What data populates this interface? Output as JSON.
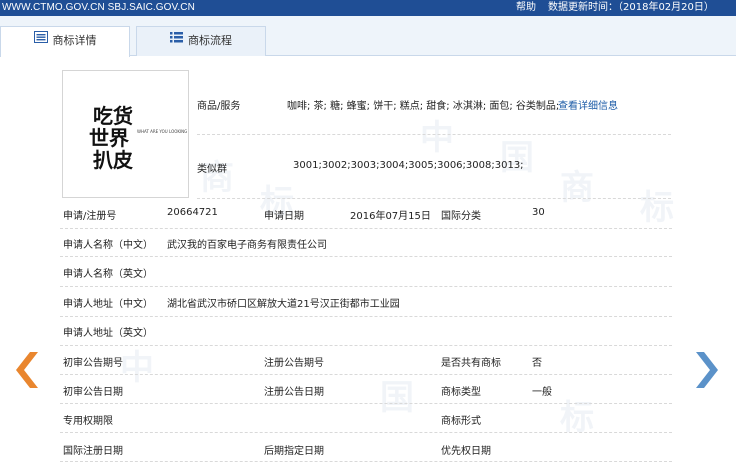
{
  "topbar": {
    "url": "WWW.CTMO.GOV.CN SBJ.SAIC.GOV.CN",
    "help": "帮助",
    "update_label": "数据更新时间：（2018年02月20日）"
  },
  "tabs": [
    {
      "label": "商标详情",
      "active": true
    },
    {
      "label": "商标流程",
      "active": false
    }
  ],
  "logo": {
    "line1": "吃货",
    "line2": "世界",
    "line3": "扒皮",
    "small_text": "WHAT ARE YOU LOOKING"
  },
  "goods": {
    "label": "商品/服务",
    "value": "咖啡; 茶; 糖; 蜂蜜; 饼干; 糕点; 甜食; 冰淇淋; 面包; 谷类制品;",
    "link": "查看详细信息"
  },
  "similar_group": {
    "label": "类似群",
    "value": "3001;3002;3003;3004;3005;3006;3008;3013;"
  },
  "fields": {
    "reg_no_label": "申请/注册号",
    "reg_no": "20664721",
    "apply_date_label": "申请日期",
    "apply_date": "2016年07月15日",
    "intl_class_label": "国际分类",
    "intl_class": "30",
    "applicant_cn_label": "申请人名称（中文）",
    "applicant_cn": "武汉我的百家电子商务有限责任公司",
    "applicant_en_label": "申请人名称（英文）",
    "address_cn_label": "申请人地址（中文）",
    "address_cn": "湖北省武汉市硚口区解放大道21号汉正街都市工业园",
    "address_en_label": "申请人地址（英文）",
    "prelim_pub_no_label": "初审公告期号",
    "reg_pub_no_label": "注册公告期号",
    "shared_label": "是否共有商标",
    "shared": "否",
    "prelim_pub_date_label": "初审公告日期",
    "reg_pub_date_label": "注册公告日期",
    "tm_type_label": "商标类型",
    "tm_type": "一般",
    "exclusive_label": "专用权期限",
    "tm_form_label": "商标形式",
    "intl_reg_date_label": "国际注册日期",
    "later_designation_label": "后期指定日期",
    "priority_date_label": "优先权日期"
  },
  "watermark": [
    "中",
    "国",
    "商",
    "标"
  ],
  "colors": {
    "topbar": "#1f4e95",
    "accent_arrow": "#e9862f",
    "next_arrow": "#5b92c9",
    "link": "#1a5aa6"
  },
  "icons": {
    "prev": "chevron-left-icon",
    "next": "chevron-right-icon",
    "detail_tab": "list-card-icon",
    "flow_tab": "list-icon"
  }
}
